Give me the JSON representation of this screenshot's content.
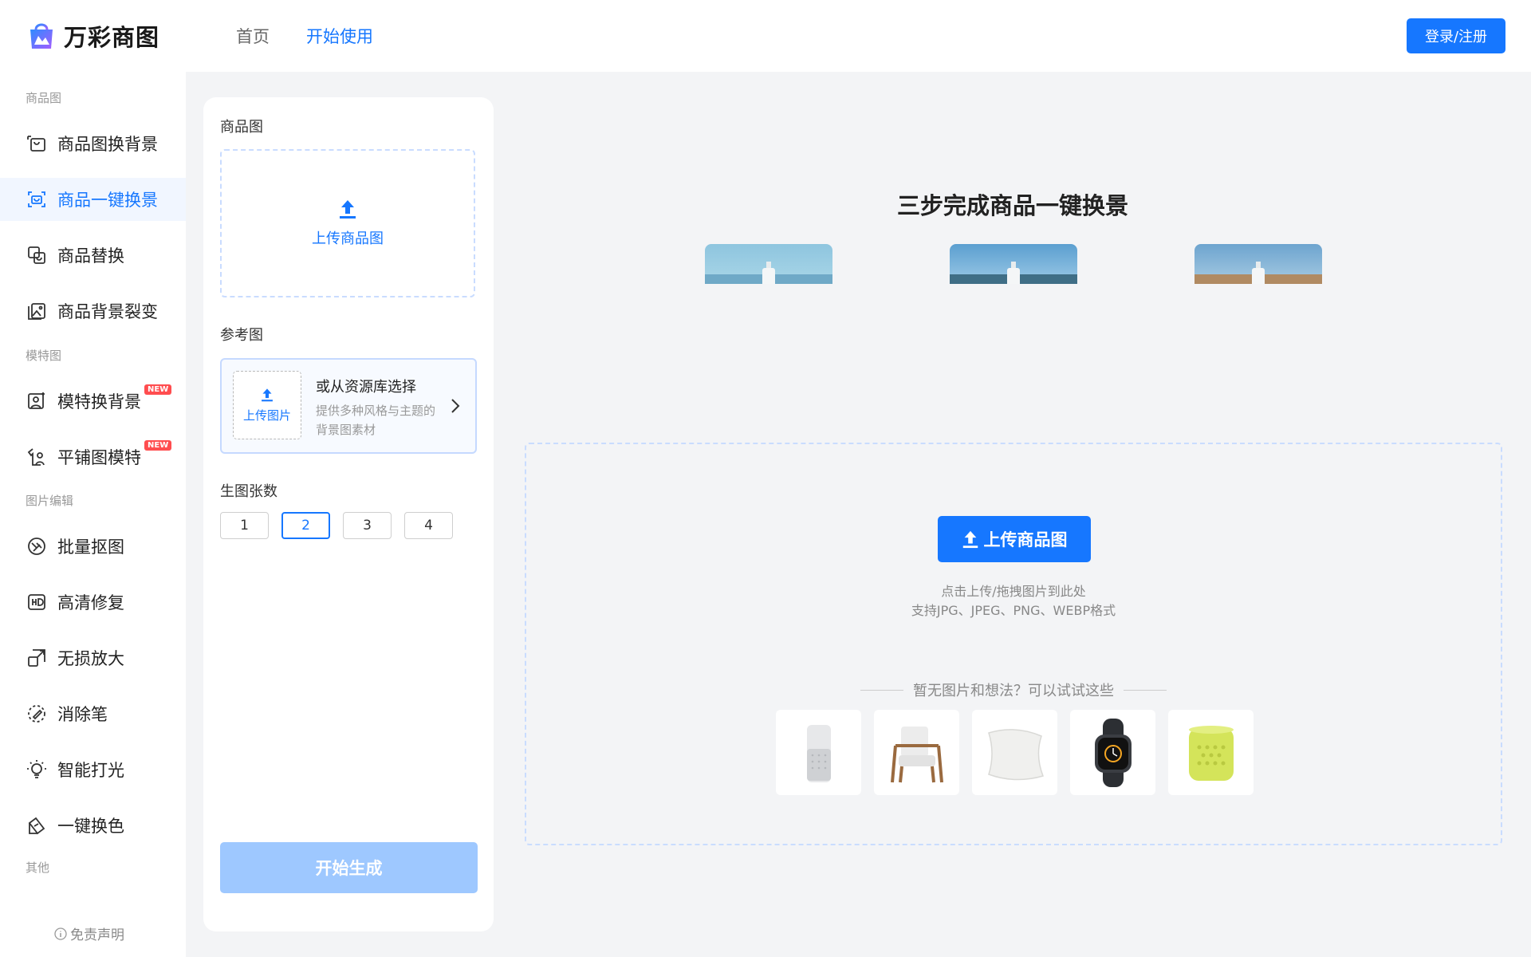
{
  "header": {
    "logo_text": "万彩商图",
    "nav": [
      {
        "label": "首页",
        "active": false
      },
      {
        "label": "开始使用",
        "active": true
      }
    ],
    "login_label": "登录/注册"
  },
  "sidebar": {
    "groups": {
      "product": "商品图",
      "model": "模特图",
      "edit": "图片编辑",
      "other": "其他"
    },
    "items": [
      {
        "label": "商品图换背景",
        "icon": "image-swap-icon"
      },
      {
        "label": "商品一键换景",
        "icon": "scene-swap-icon",
        "active": true
      },
      {
        "label": "商品替换",
        "icon": "product-replace-icon"
      },
      {
        "label": "商品背景裂变",
        "icon": "background-variant-icon"
      },
      {
        "label": "模特换背景",
        "icon": "model-background-icon",
        "badge": "NEW"
      },
      {
        "label": "平铺图模特",
        "icon": "flatlay-model-icon",
        "badge": "NEW"
      },
      {
        "label": "批量抠图",
        "icon": "batch-cutout-icon"
      },
      {
        "label": "高清修复",
        "icon": "hd-icon"
      },
      {
        "label": "无损放大",
        "icon": "enlarge-icon"
      },
      {
        "label": "消除笔",
        "icon": "eraser-icon"
      },
      {
        "label": "智能打光",
        "icon": "bulb-icon"
      },
      {
        "label": "一键换色",
        "icon": "recolor-icon"
      }
    ],
    "disclaimer": "免责声明"
  },
  "panel": {
    "product_label": "商品图",
    "product_upload": "上传商品图",
    "reference_label": "参考图",
    "reference_upload": "上传图片",
    "reference_title": "或从资源库选择",
    "reference_desc": "提供多种风格与主题的背景图素材",
    "count_label": "生图张数",
    "counts": [
      "1",
      "2",
      "3",
      "4"
    ],
    "selected_count": "2",
    "generate_label": "开始生成"
  },
  "main": {
    "steps_title": "三步完成商品一键换景",
    "upload_button": "上传商品图",
    "hint_1": "点击上传/拖拽图片到此处",
    "hint_2": "支持JPG、JPEG、PNG、WEBP格式",
    "try_title": "暂无图片和想法？可以试试这些",
    "samples": [
      "air-purifier",
      "armchair",
      "pillow",
      "smartwatch",
      "speaker"
    ]
  },
  "colors": {
    "accent": "#1677ff",
    "badge": "#ff4d4f",
    "disabled_button": "#9ec8ff"
  }
}
